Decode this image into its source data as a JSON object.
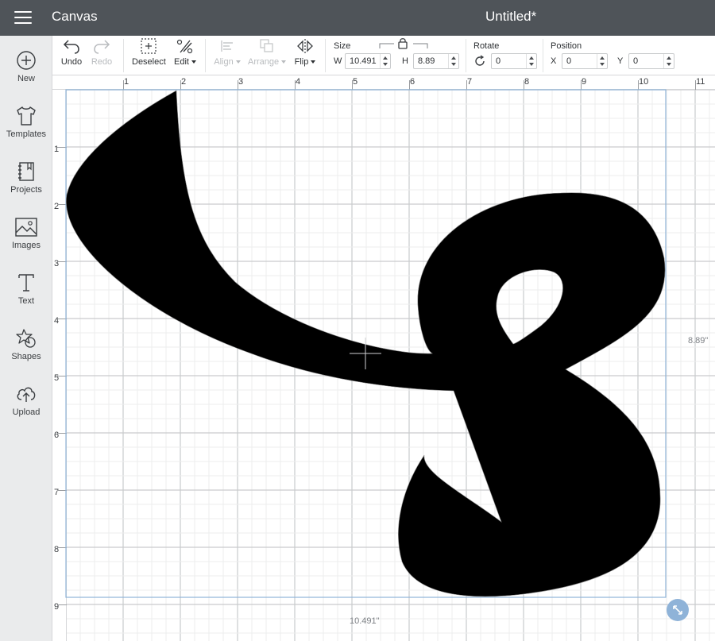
{
  "titlebar": {
    "app_title": "Canvas",
    "doc_title": "Untitled*"
  },
  "sidebar": {
    "items": [
      {
        "label": "New",
        "icon": "plus-circle-icon"
      },
      {
        "label": "Templates",
        "icon": "tshirt-icon"
      },
      {
        "label": "Projects",
        "icon": "notebook-icon"
      },
      {
        "label": "Images",
        "icon": "image-icon"
      },
      {
        "label": "Text",
        "icon": "text-t-icon"
      },
      {
        "label": "Shapes",
        "icon": "shapes-icon"
      },
      {
        "label": "Upload",
        "icon": "cloud-upload-icon"
      }
    ]
  },
  "toolbar": {
    "undo_label": "Undo",
    "redo_label": "Redo",
    "deselect_label": "Deselect",
    "edit_label": "Edit",
    "align_label": "Align",
    "arrange_label": "Arrange",
    "flip_label": "Flip",
    "size": {
      "title": "Size",
      "w_label": "W",
      "w_value": "10.491",
      "h_label": "H",
      "h_value": "8.89"
    },
    "rotate": {
      "title": "Rotate",
      "value": "0"
    },
    "position": {
      "title": "Position",
      "x_label": "X",
      "x_value": "0",
      "y_label": "Y",
      "y_value": "0"
    }
  },
  "rulers": {
    "top": [
      "1",
      "2",
      "3",
      "4",
      "5",
      "6",
      "7",
      "8",
      "9",
      "10",
      "11"
    ],
    "left": [
      "1",
      "2",
      "3",
      "4",
      "5",
      "6",
      "7",
      "8",
      "9"
    ]
  },
  "canvas": {
    "width_label": "10.491\"",
    "height_label": "8.89\"",
    "selection_color": "#8fb3d8",
    "shape_color": "#000000"
  }
}
